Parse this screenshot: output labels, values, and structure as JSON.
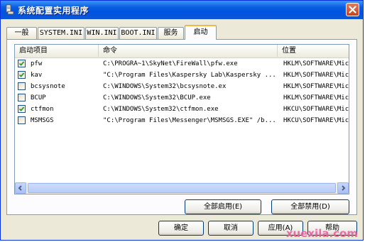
{
  "window": {
    "title": "系统配置实用程序"
  },
  "tabs": [
    {
      "label": "一般"
    },
    {
      "label": "SYSTEM.INI"
    },
    {
      "label": "WIN.INI"
    },
    {
      "label": "BOOT.INI"
    },
    {
      "label": "服务"
    },
    {
      "label": "启动",
      "active": true
    }
  ],
  "list": {
    "columns": [
      "启动项目",
      "命令",
      "位置"
    ],
    "rows": [
      {
        "checked": true,
        "item": "pfw",
        "command": "C:\\PROGRA~1\\SkyNet\\FireWall\\pfw.exe",
        "location": "HKLM\\SOFTWARE\\Micr"
      },
      {
        "checked": true,
        "item": "kav",
        "command": "\"C:\\Program Files\\Kaspersky Lab\\Kaspersky ...",
        "location": "HKLM\\SOFTWARE\\Micr"
      },
      {
        "checked": false,
        "item": "bcsysnote",
        "command": "C:\\WINDOWS\\System32\\bcsysnote.ex",
        "location": "HKLM\\SOFTWARE\\Micr"
      },
      {
        "checked": false,
        "item": "BCUP",
        "command": "C:\\WINDOWS\\System32\\BCUP.exe",
        "location": "HKLM\\SOFTWARE\\Micr"
      },
      {
        "checked": true,
        "item": "ctfmon",
        "command": "C:\\WINDOWS\\System32\\ctfmon.exe",
        "location": "HKCU\\SOFTWARE\\Micr"
      },
      {
        "checked": false,
        "item": "MSMSGS",
        "command": "\"C:\\Program Files\\Messenger\\MSMSGS.EXE\" /b...",
        "location": "HKCU\\SOFTWARE\\Micr"
      }
    ]
  },
  "buttons": {
    "enable_all": "全部启用(E)",
    "disable_all": "全部禁用(D)",
    "ok": "确定",
    "cancel": "取消",
    "apply": "应用(A)",
    "help": "帮助"
  },
  "watermark": "xuexila.com"
}
